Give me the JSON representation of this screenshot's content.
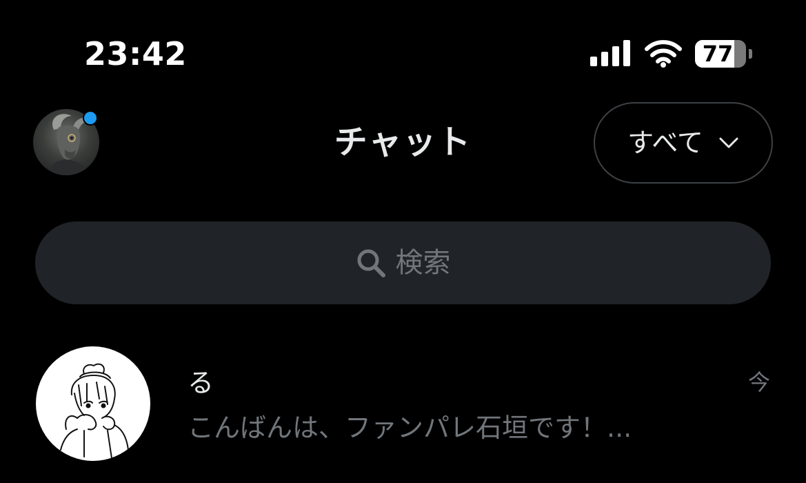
{
  "status_bar": {
    "time": "23:42",
    "battery_level": "77",
    "battery_fraction": 0.77,
    "signal_bars": 4,
    "wifi_icon": "wifi-icon",
    "signal_icon": "cellular-signal-icon"
  },
  "header": {
    "title": "チャット",
    "filter_label": "すべて",
    "filter_icon": "chevron-down-icon",
    "avatar_icon": "profile-avatar",
    "presence_color": "#1d9bf0"
  },
  "search": {
    "placeholder": "検索",
    "icon": "search-icon"
  },
  "chats": [
    {
      "name": "る",
      "time": "今",
      "preview": "こんばんは、ファンパレ石垣です！..."
    }
  ],
  "colors": {
    "background": "#000000",
    "primary_text": "#e7e9ea",
    "secondary_text": "#71767b",
    "search_background": "#202327",
    "accent": "#1d9bf0"
  }
}
